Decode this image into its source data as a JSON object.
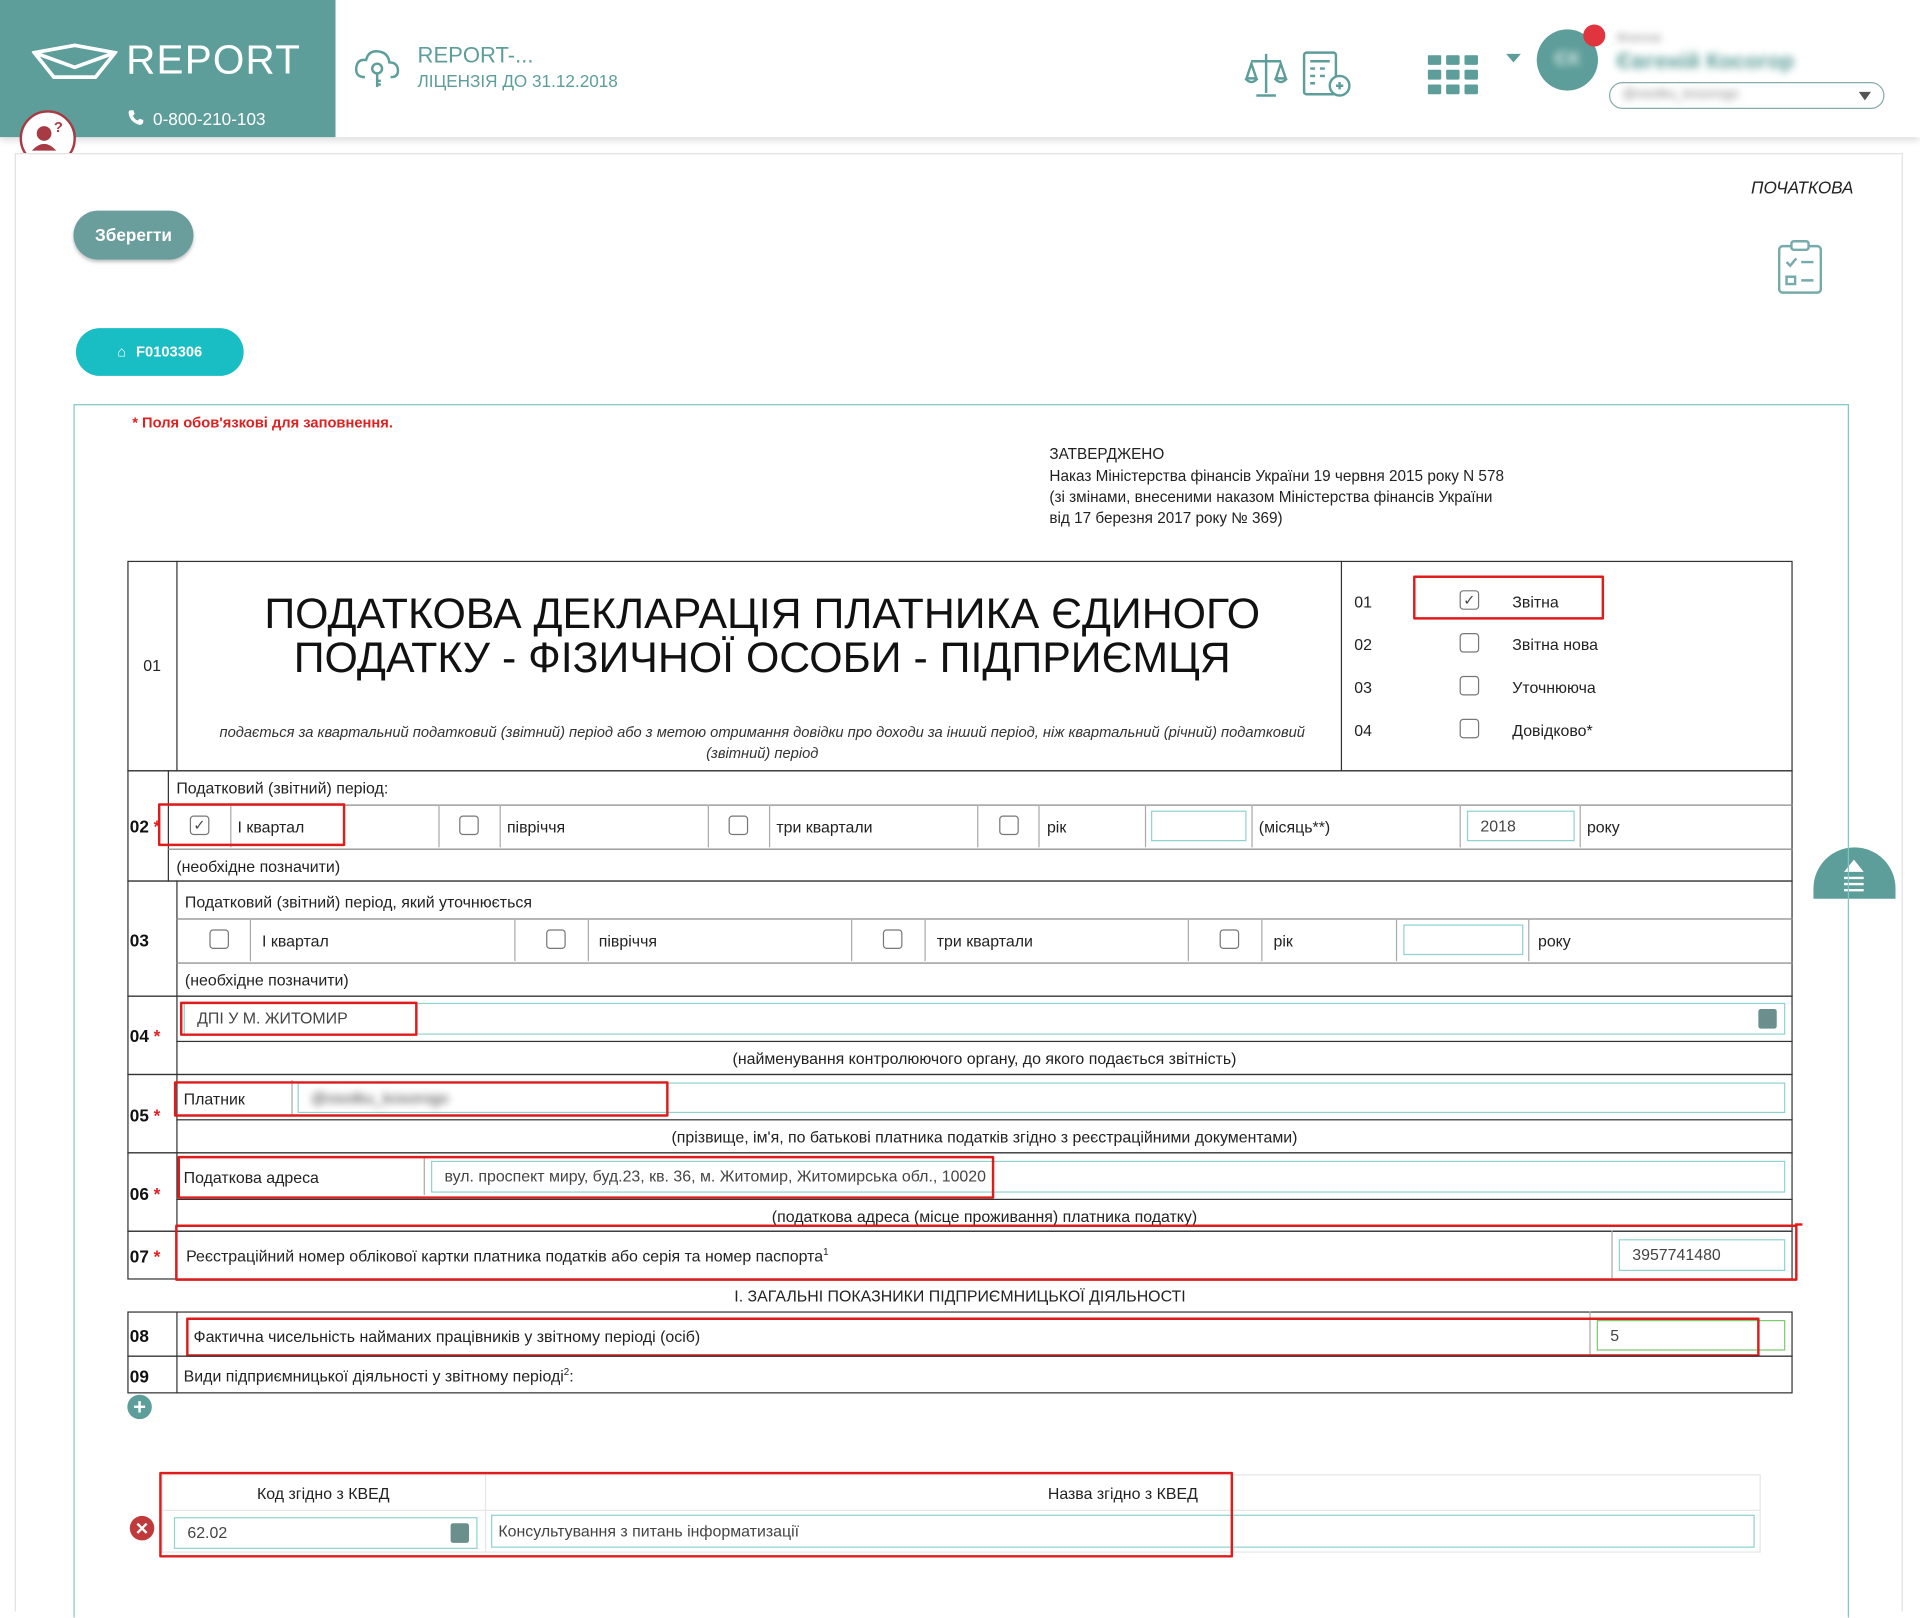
{
  "header": {
    "logo_text": "REPORT",
    "phone": "0-800-210-103",
    "license_title": "REPORT-...",
    "license_sub": "ЛІЦЕНЗІЯ ДО 31.12.2018",
    "user_name": "Євгеній Косогор",
    "user_org": "@osotku_kosorogo",
    "avatar_initials": "ЄК",
    "avatar_caption": "Фізична"
  },
  "toolbar": {
    "status": "ПОЧАТКОВА",
    "save_label": "Зберегти",
    "form_tab_label": "F0103306"
  },
  "form": {
    "required_note": "* Поля обов'язкові для заповнення.",
    "approved": {
      "line1": "ЗАТВЕРДЖЕНО",
      "line2": "Наказ Міністерства фінансів України 19 червня 2015 року N 578",
      "line3": "(зі змінами, внесеними наказом Міністерства фінансів України",
      "line4": "від 17 березня 2017 року № 369)"
    },
    "title_code": "01",
    "title_line1": "ПОДАТКОВА ДЕКЛАРАЦІЯ ПЛАТНИКА ЄДИНОГО",
    "title_line2": "ПОДАТКУ - ФІЗИЧНОЇ ОСОБИ - ПІДПРИЄМЦЯ",
    "subtitle_line1": "подається за квартальний податковий (звітний) період або з метою отримання довідки про доходи за інший період, ніж квартальний (річний) податковий",
    "subtitle_line2": "(звітний) період",
    "doc_types": [
      {
        "code": "01",
        "label": "Звітна",
        "checked": true
      },
      {
        "code": "02",
        "label": "Звітна нова",
        "checked": false
      },
      {
        "code": "03",
        "label": "Уточнююча",
        "checked": false
      },
      {
        "code": "04",
        "label": "Довідково*",
        "checked": false
      }
    ],
    "row02": {
      "num": "02",
      "caption": "Податковий (звітний) період:",
      "options": [
        "I квартал",
        "півріччя",
        "три квартали",
        "рік"
      ],
      "checked_index": 0,
      "month_label": "(місяць**)",
      "year_value": "2018",
      "year_suffix": "року",
      "note": "(необхідне позначити)"
    },
    "row03": {
      "num": "03",
      "caption": "Податковий (звітний) період, який уточнюється",
      "options": [
        "I квартал",
        "півріччя",
        "три квартали",
        "рік"
      ],
      "year_suffix": "року",
      "note": "(необхідне позначити)"
    },
    "row04": {
      "num": "04",
      "value": "ДПІ У М. ЖИТОМИР",
      "note": "(найменування контролюючого органу, до якого подається звітність)"
    },
    "row05": {
      "num": "05",
      "label": "Платник",
      "value": "@osotku_kosorogo",
      "note": "(прізвище, ім'я, по батькові платника податків згідно з реєстраційними документами)"
    },
    "row06": {
      "num": "06",
      "label": "Податкова адреса",
      "value": "вул. проспект миру, буд.23, кв. 36, м. Житомир, Житомирська обл., 10020",
      "note": "(податкова адреса (місце проживання) платника податку)"
    },
    "row07": {
      "num": "07",
      "label": "Реєстраційний номер облікової картки платника податків або серія та номер паспорта",
      "sup": "1",
      "value": "3957741480"
    },
    "section1_title": "І. ЗАГАЛЬНІ ПОКАЗНИКИ ПІДПРИЄМНИЦЬКОЇ ДІЯЛЬНОСТІ",
    "row08": {
      "num": "08",
      "label": "Фактична чисельність найманих працівників у звітному періоді (осіб)",
      "value": "5"
    },
    "row09": {
      "num": "09",
      "label": "Види підприємницької діяльності у звітному періоді",
      "sup": "2",
      "suffix": ":"
    },
    "kved": {
      "code_header": "Код згідно з КВЕД",
      "name_header": "Назва згідно з КВЕД",
      "code_value": "62.02",
      "name_value": "Консультування з питань інформатизації"
    }
  },
  "colors": {
    "brand": "#5d9e9a",
    "accent": "#19bdc4",
    "highlight": "#e01b1b"
  }
}
